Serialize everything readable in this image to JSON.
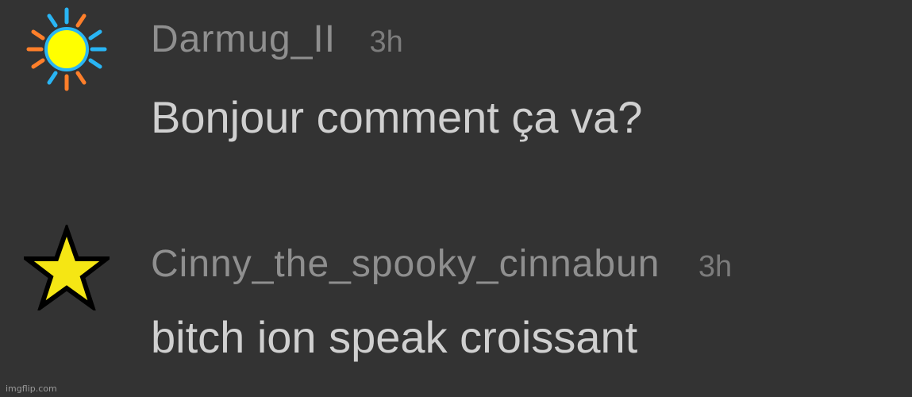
{
  "comments": [
    {
      "username": "Darmug_II",
      "timestamp": "3h",
      "text": "Bonjour comment ça va?",
      "avatar_icon": "sun-icon",
      "avatar_colors": {
        "core": "#ffff00",
        "core_outline": "#29b5f4",
        "rays_blue": "#29b5f4",
        "rays_orange": "#ff7f2a"
      }
    },
    {
      "username": "Cinny_the_spooky_cinnabun",
      "timestamp": "3h",
      "text": "bitch ion speak croissant",
      "avatar_icon": "star-icon",
      "avatar_colors": {
        "fill": "#f5e614",
        "outline": "#000000"
      }
    }
  ],
  "watermark": "imgflip.com",
  "colors": {
    "background": "#333333",
    "username": "#8f8f8f",
    "timestamp": "#7c7c7c",
    "body_text": "#d0d0d0"
  }
}
